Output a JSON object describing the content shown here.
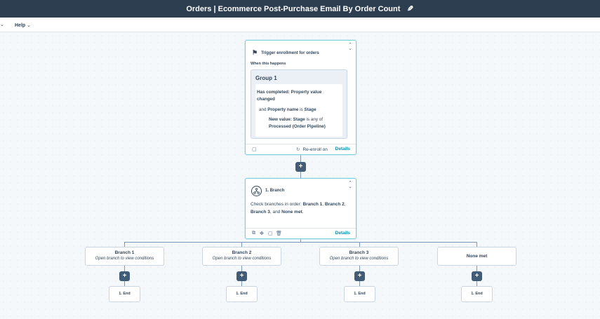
{
  "header": {
    "title": "Orders | Ecommerce Post-Purchase Email By Order Count",
    "edit_icon": "pencil-icon"
  },
  "menu": {
    "help_label": "Help"
  },
  "trigger": {
    "title": "Trigger enrollment for orders",
    "when_label": "When this happens",
    "group_title": "Group 1",
    "cond1_label": "Has completed:",
    "cond1_value": "Property value changed",
    "cond2_and": "and",
    "cond2_prop": "Property name",
    "cond2_is": "is",
    "cond2_value": "Stage",
    "cond3_label": "New value: Stage",
    "cond3_op": "is any of",
    "cond3_value": "Processed (Order Pipeline)",
    "reenroll_label": "Re-enroll on",
    "details_label": "Details"
  },
  "branch_action": {
    "title": "1. Branch",
    "desc_prefix": "Check branches in order:",
    "b1": "Branch 1",
    "b2": "Branch 2",
    "b3": "Branch 3",
    "and_word": "and",
    "none": "None met",
    "details_label": "Details"
  },
  "branches": [
    {
      "name": "Branch 1",
      "sub": "Open branch to view conditions",
      "end": "1. End"
    },
    {
      "name": "Branch 2",
      "sub": "Open branch to view conditions",
      "end": "1. End"
    },
    {
      "name": "Branch 3",
      "sub": "Open branch to view conditions",
      "end": "1. End"
    },
    {
      "name": "None met",
      "sub": "",
      "end": "1. End"
    }
  ],
  "colors": {
    "topbar": "#2d3e50",
    "accent_link": "#0091ae",
    "plus_button": "#425b76",
    "card_border": "#7fd1de"
  }
}
